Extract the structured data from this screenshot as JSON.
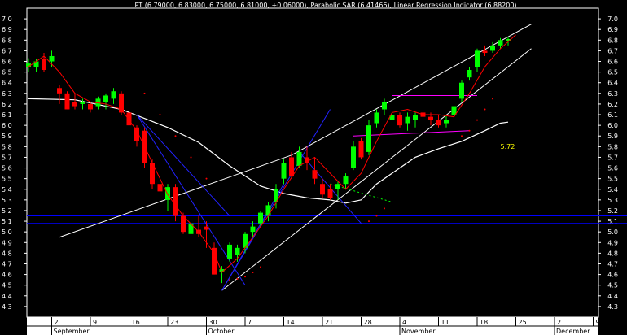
{
  "title": "PT (6.79000, 6.83000, 6.75000, 6.81000, +0.06000), Parabolic SAR (6.41466), Linear Regression Indicator (6.88200)",
  "colors": {
    "background": "#000000",
    "up_candle": "#00ff00",
    "down_candle": "#ff0000",
    "horizontal_line": "#0000ff",
    "trend_line": "#ffffff",
    "fan_line": "#2222ff",
    "moving_average": "#ffffff",
    "regression": "#ff0000",
    "sar_dots": "#ff0000",
    "resistance": "#ff00ff",
    "annotation": "#ffff00",
    "dotted_projection": "#00ff00",
    "date_axis_bg": "#ffffff"
  },
  "chart_data": {
    "type": "candlestick",
    "title": "PT (6.79000, 6.83000, 6.75000, 6.81000, +0.06000), Parabolic SAR (6.41466), Linear Regression Indicator (6.88200)",
    "ylim": [
      4.2,
      7.1
    ],
    "y_ticks": [
      4.3,
      4.4,
      4.5,
      4.6,
      4.7,
      4.8,
      4.9,
      5.0,
      5.1,
      5.2,
      5.3,
      5.4,
      5.5,
      5.6,
      5.7,
      5.8,
      5.9,
      6.0,
      6.1,
      6.2,
      6.3,
      6.4,
      6.5,
      6.6,
      6.7,
      6.8,
      6.9,
      7.0
    ],
    "x_ticks": [
      {
        "label": "2",
        "day": 3
      },
      {
        "label": "9",
        "day": 8
      },
      {
        "label": "16",
        "day": 13
      },
      {
        "label": "23",
        "day": 18
      },
      {
        "label": "30",
        "day": 23
      },
      {
        "label": "7",
        "day": 28
      },
      {
        "label": "14",
        "day": 33
      },
      {
        "label": "21",
        "day": 38
      },
      {
        "label": "28",
        "day": 43
      },
      {
        "label": "4",
        "day": 48
      },
      {
        "label": "11",
        "day": 53
      },
      {
        "label": "18",
        "day": 58
      },
      {
        "label": "25",
        "day": 63
      },
      {
        "label": "2",
        "day": 68
      },
      {
        "label": "9",
        "day": 73
      }
    ],
    "months": [
      {
        "label": "September",
        "day": 3
      },
      {
        "label": "October",
        "day": 23
      },
      {
        "label": "November",
        "day": 48
      },
      {
        "label": "December",
        "day": 68
      }
    ],
    "horizontal_levels": [
      5.73,
      5.15,
      5.08
    ],
    "annotation": {
      "text": "5.72",
      "day": 61,
      "value": 5.78
    },
    "candles": [
      {
        "o": 6.55,
        "h": 6.63,
        "l": 6.5,
        "c": 6.58
      },
      {
        "o": 6.55,
        "h": 6.62,
        "l": 6.5,
        "c": 6.6
      },
      {
        "o": 6.62,
        "h": 6.68,
        "l": 6.5,
        "c": 6.52
      },
      {
        "o": 6.6,
        "h": 6.7,
        "l": 6.55,
        "c": 6.65
      },
      {
        "o": 6.35,
        "h": 6.38,
        "l": 6.2,
        "c": 6.3
      },
      {
        "o": 6.3,
        "h": 6.32,
        "l": 6.15,
        "c": 6.15
      },
      {
        "o": 6.22,
        "h": 6.3,
        "l": 6.15,
        "c": 6.18
      },
      {
        "o": 6.2,
        "h": 6.25,
        "l": 6.15,
        "c": 6.22
      },
      {
        "o": 6.2,
        "h": 6.22,
        "l": 6.12,
        "c": 6.15
      },
      {
        "o": 6.18,
        "h": 6.27,
        "l": 6.15,
        "c": 6.25
      },
      {
        "o": 6.22,
        "h": 6.3,
        "l": 6.15,
        "c": 6.28
      },
      {
        "o": 6.25,
        "h": 6.35,
        "l": 6.2,
        "c": 6.32
      },
      {
        "o": 6.3,
        "h": 6.32,
        "l": 6.1,
        "c": 6.12
      },
      {
        "o": 6.12,
        "h": 6.15,
        "l": 5.95,
        "c": 6.0
      },
      {
        "o": 5.98,
        "h": 6.0,
        "l": 5.8,
        "c": 5.85
      },
      {
        "o": 5.95,
        "h": 5.98,
        "l": 5.6,
        "c": 5.65
      },
      {
        "o": 5.65,
        "h": 5.68,
        "l": 5.4,
        "c": 5.45
      },
      {
        "o": 5.45,
        "h": 5.5,
        "l": 5.25,
        "c": 5.38
      },
      {
        "o": 5.3,
        "h": 5.45,
        "l": 5.2,
        "c": 5.42
      },
      {
        "o": 5.42,
        "h": 5.45,
        "l": 5.1,
        "c": 5.15
      },
      {
        "o": 5.15,
        "h": 5.18,
        "l": 4.98,
        "c": 5.0
      },
      {
        "o": 4.98,
        "h": 5.12,
        "l": 4.95,
        "c": 5.08
      },
      {
        "o": 5.02,
        "h": 5.15,
        "l": 4.95,
        "c": 4.98
      },
      {
        "o": 5.05,
        "h": 5.1,
        "l": 4.85,
        "c": 5.02
      },
      {
        "o": 4.85,
        "h": 4.9,
        "l": 4.6,
        "c": 4.6
      },
      {
        "o": 4.62,
        "h": 4.68,
        "l": 4.52,
        "c": 4.65
      },
      {
        "o": 4.75,
        "h": 4.9,
        "l": 4.72,
        "c": 4.88
      },
      {
        "o": 4.78,
        "h": 4.88,
        "l": 4.72,
        "c": 4.85
      },
      {
        "o": 4.85,
        "h": 5.0,
        "l": 4.8,
        "c": 4.98
      },
      {
        "o": 5.0,
        "h": 5.1,
        "l": 4.95,
        "c": 5.05
      },
      {
        "o": 5.08,
        "h": 5.2,
        "l": 5.05,
        "c": 5.18
      },
      {
        "o": 5.15,
        "h": 5.28,
        "l": 5.1,
        "c": 5.25
      },
      {
        "o": 5.28,
        "h": 5.45,
        "l": 5.22,
        "c": 5.4
      },
      {
        "o": 5.5,
        "h": 5.68,
        "l": 5.45,
        "c": 5.65
      },
      {
        "o": 5.7,
        "h": 5.75,
        "l": 5.5,
        "c": 5.52
      },
      {
        "o": 5.62,
        "h": 5.8,
        "l": 5.6,
        "c": 5.75
      },
      {
        "o": 5.7,
        "h": 5.8,
        "l": 5.58,
        "c": 5.65
      },
      {
        "o": 5.58,
        "h": 5.7,
        "l": 5.45,
        "c": 5.5
      },
      {
        "o": 5.45,
        "h": 5.5,
        "l": 5.32,
        "c": 5.35
      },
      {
        "o": 5.4,
        "h": 5.45,
        "l": 5.3,
        "c": 5.32
      },
      {
        "o": 5.4,
        "h": 5.48,
        "l": 5.3,
        "c": 5.45
      },
      {
        "o": 5.45,
        "h": 5.55,
        "l": 5.4,
        "c": 5.52
      },
      {
        "o": 5.6,
        "h": 5.85,
        "l": 5.58,
        "c": 5.8
      },
      {
        "o": 5.85,
        "h": 5.88,
        "l": 5.68,
        "c": 5.7
      },
      {
        "o": 5.75,
        "h": 6.05,
        "l": 5.72,
        "c": 6.0
      },
      {
        "o": 6.02,
        "h": 6.15,
        "l": 5.98,
        "c": 6.12
      },
      {
        "o": 6.15,
        "h": 6.25,
        "l": 6.1,
        "c": 6.22
      },
      {
        "o": 6.05,
        "h": 6.12,
        "l": 5.95,
        "c": 6.1
      },
      {
        "o": 6.1,
        "h": 6.12,
        "l": 5.98,
        "c": 6.0
      },
      {
        "o": 6.02,
        "h": 6.12,
        "l": 5.95,
        "c": 6.08
      },
      {
        "o": 6.05,
        "h": 6.12,
        "l": 5.98,
        "c": 6.1
      },
      {
        "o": 6.12,
        "h": 6.15,
        "l": 6.05,
        "c": 6.08
      },
      {
        "o": 6.08,
        "h": 6.12,
        "l": 6.0,
        "c": 6.05
      },
      {
        "o": 6.05,
        "h": 6.1,
        "l": 5.98,
        "c": 6.0
      },
      {
        "o": 6.02,
        "h": 6.1,
        "l": 5.98,
        "c": 6.05
      },
      {
        "o": 6.1,
        "h": 6.2,
        "l": 6.05,
        "c": 6.18
      },
      {
        "o": 6.25,
        "h": 6.42,
        "l": 6.22,
        "c": 6.4
      },
      {
        "o": 6.45,
        "h": 6.55,
        "l": 6.42,
        "c": 6.52
      },
      {
        "o": 6.55,
        "h": 6.72,
        "l": 6.5,
        "c": 6.7
      },
      {
        "o": 6.7,
        "h": 6.75,
        "l": 6.65,
        "c": 6.68
      },
      {
        "o": 6.7,
        "h": 6.78,
        "l": 6.68,
        "c": 6.75
      },
      {
        "o": 6.75,
        "h": 6.82,
        "l": 6.72,
        "c": 6.8
      },
      {
        "o": 6.79,
        "h": 6.83,
        "l": 6.75,
        "c": 6.81
      }
    ],
    "moving_average": [
      [
        0,
        6.25
      ],
      [
        6,
        6.24
      ],
      [
        12,
        6.15
      ],
      [
        18,
        5.98
      ],
      [
        22,
        5.84
      ],
      [
        26,
        5.62
      ],
      [
        30,
        5.43
      ],
      [
        33,
        5.36
      ],
      [
        36,
        5.32
      ],
      [
        39,
        5.3
      ],
      [
        41,
        5.27
      ],
      [
        43,
        5.3
      ],
      [
        45,
        5.45
      ],
      [
        48,
        5.6
      ],
      [
        50,
        5.7
      ],
      [
        53,
        5.78
      ],
      [
        56,
        5.85
      ],
      [
        59,
        5.95
      ],
      [
        61,
        6.02
      ],
      [
        62,
        6.03
      ]
    ],
    "regression_line": [
      [
        0,
        6.55
      ],
      [
        2,
        6.65
      ],
      [
        4,
        6.5
      ],
      [
        6,
        6.3
      ],
      [
        8,
        6.22
      ],
      [
        10,
        6.2
      ],
      [
        12,
        6.15
      ],
      [
        14,
        5.95
      ],
      [
        16,
        5.65
      ],
      [
        18,
        5.35
      ],
      [
        20,
        5.15
      ],
      [
        22,
        5.0
      ],
      [
        24,
        4.8
      ],
      [
        25,
        4.62
      ],
      [
        27,
        4.75
      ],
      [
        29,
        4.95
      ],
      [
        31,
        5.15
      ],
      [
        33,
        5.4
      ],
      [
        35,
        5.62
      ],
      [
        37,
        5.7
      ],
      [
        39,
        5.55
      ],
      [
        41,
        5.4
      ],
      [
        43,
        5.55
      ],
      [
        45,
        5.85
      ],
      [
        47,
        6.12
      ],
      [
        49,
        6.15
      ],
      [
        51,
        6.1
      ],
      [
        53,
        6.1
      ],
      [
        55,
        6.08
      ],
      [
        57,
        6.3
      ],
      [
        59,
        6.55
      ],
      [
        61,
        6.72
      ],
      [
        63,
        6.85
      ]
    ],
    "sar_dots": [
      [
        15,
        6.3
      ],
      [
        17,
        6.1
      ],
      [
        19,
        5.9
      ],
      [
        21,
        5.7
      ],
      [
        23,
        5.5
      ],
      [
        26,
        4.55
      ],
      [
        27,
        4.56
      ],
      [
        28,
        4.58
      ],
      [
        29,
        4.62
      ],
      [
        30,
        4.67
      ],
      [
        44,
        5.1
      ],
      [
        45,
        5.15
      ],
      [
        46,
        5.22
      ],
      [
        56,
        5.9
      ],
      [
        57,
        5.95
      ],
      [
        58,
        6.05
      ],
      [
        59,
        6.15
      ],
      [
        60,
        6.25
      ]
    ],
    "trend_lines": [
      {
        "p1": [
          4,
          4.95
        ],
        "p2": [
          34,
          5.72
        ],
        "color": "#ffffff"
      },
      {
        "p1": [
          34,
          5.72
        ],
        "p2": [
          65,
          6.95
        ],
        "color": "#ffffff"
      },
      {
        "p1": [
          25,
          4.45
        ],
        "p2": [
          65,
          6.72
        ],
        "color": "#ffffff"
      },
      {
        "p1": [
          42,
          5.9
        ],
        "p2": [
          57,
          5.95
        ],
        "color": "#ff00ff"
      },
      {
        "p1": [
          47,
          6.28
        ],
        "p2": [
          58,
          6.28
        ],
        "color": "#ff00ff"
      }
    ],
    "fan_lines": [
      {
        "p1": [
          14,
          6.1
        ],
        "p2": [
          28,
          4.5
        ],
        "color": "#2222ff"
      },
      {
        "p1": [
          14,
          6.1
        ],
        "p2": [
          26,
          5.15
        ],
        "color": "#2222ff"
      },
      {
        "p1": [
          25,
          4.45
        ],
        "p2": [
          39,
          6.15
        ],
        "color": "#2222ff"
      },
      {
        "p1": [
          25,
          4.45
        ],
        "p2": [
          33,
          5.45
        ],
        "color": "#2222ff"
      },
      {
        "p1": [
          35,
          5.75
        ],
        "p2": [
          43,
          5.08
        ],
        "color": "#2222ff"
      }
    ],
    "dotted_projection": [
      [
        39,
        5.45
      ],
      [
        47,
        5.28
      ]
    ]
  }
}
